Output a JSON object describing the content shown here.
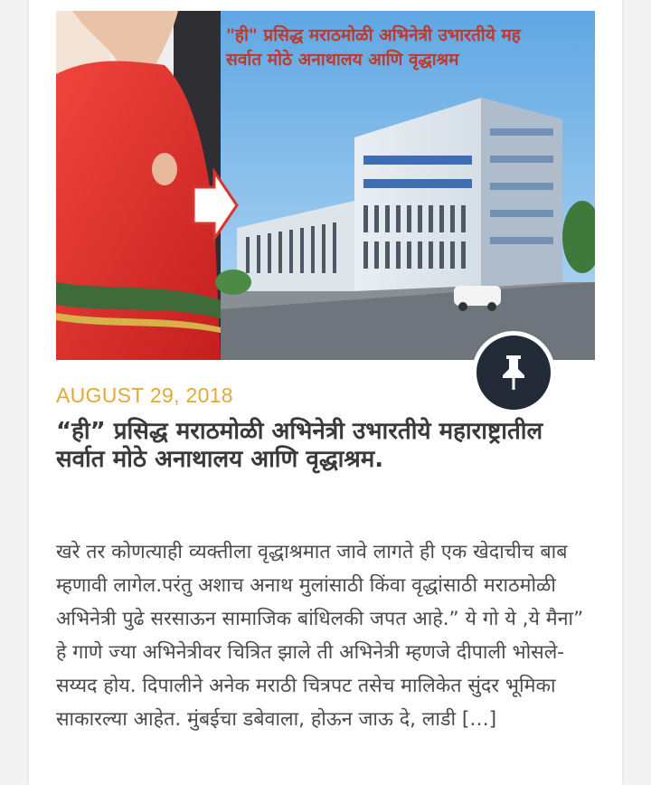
{
  "post": {
    "image_caption_line1": "\"ही\" प्रसिद्ध मराठमोळी अभिनेत्री उभारतीये मह",
    "image_caption_line2": "सर्वात मोठे अनाथालय आणि वृद्धाश्रम",
    "pin_icon": "pushpin-icon",
    "date": "AUGUST 29, 2018",
    "title": "“ही” प्रसिद्ध मराठमोळी अभिनेत्री उभारतीये महाराष्ट्रातील सर्वात मोठे अनाथालय आणि वृद्धाश्रम.",
    "excerpt": "खरे तर कोणत्याही व्यक्तीला वृद्धाश्रमात जावे लागते ही एक खेदाचीच बाब म्हणावी लागेल.परंतु अशाच अनाथ मुलांसाठी किंवा वृद्धांसाठी मराठमोळी अभिनेत्री पुढे सरसाऊन सामाजिक बांधिलकी जपत आहे.” ये गो ये ,ये मैना” हे गाणे ज्या अभिनेत्रीवर चित्रित झाले ती अभिनेत्री म्हणजे दीपाली भोसले- सय्यद होय. दिपालीने अनेक मराठी चित्रपट तसेच मालिकेत सुंदर भूमिका साकारल्या आहेत. मुंबईचा डबेवाला, होऊन जाऊ दे, लाडी […]"
  },
  "colors": {
    "date": "#e0a93a",
    "title": "#3a3a3a",
    "pin_bg": "#242b38",
    "caption": "#c0392b"
  }
}
